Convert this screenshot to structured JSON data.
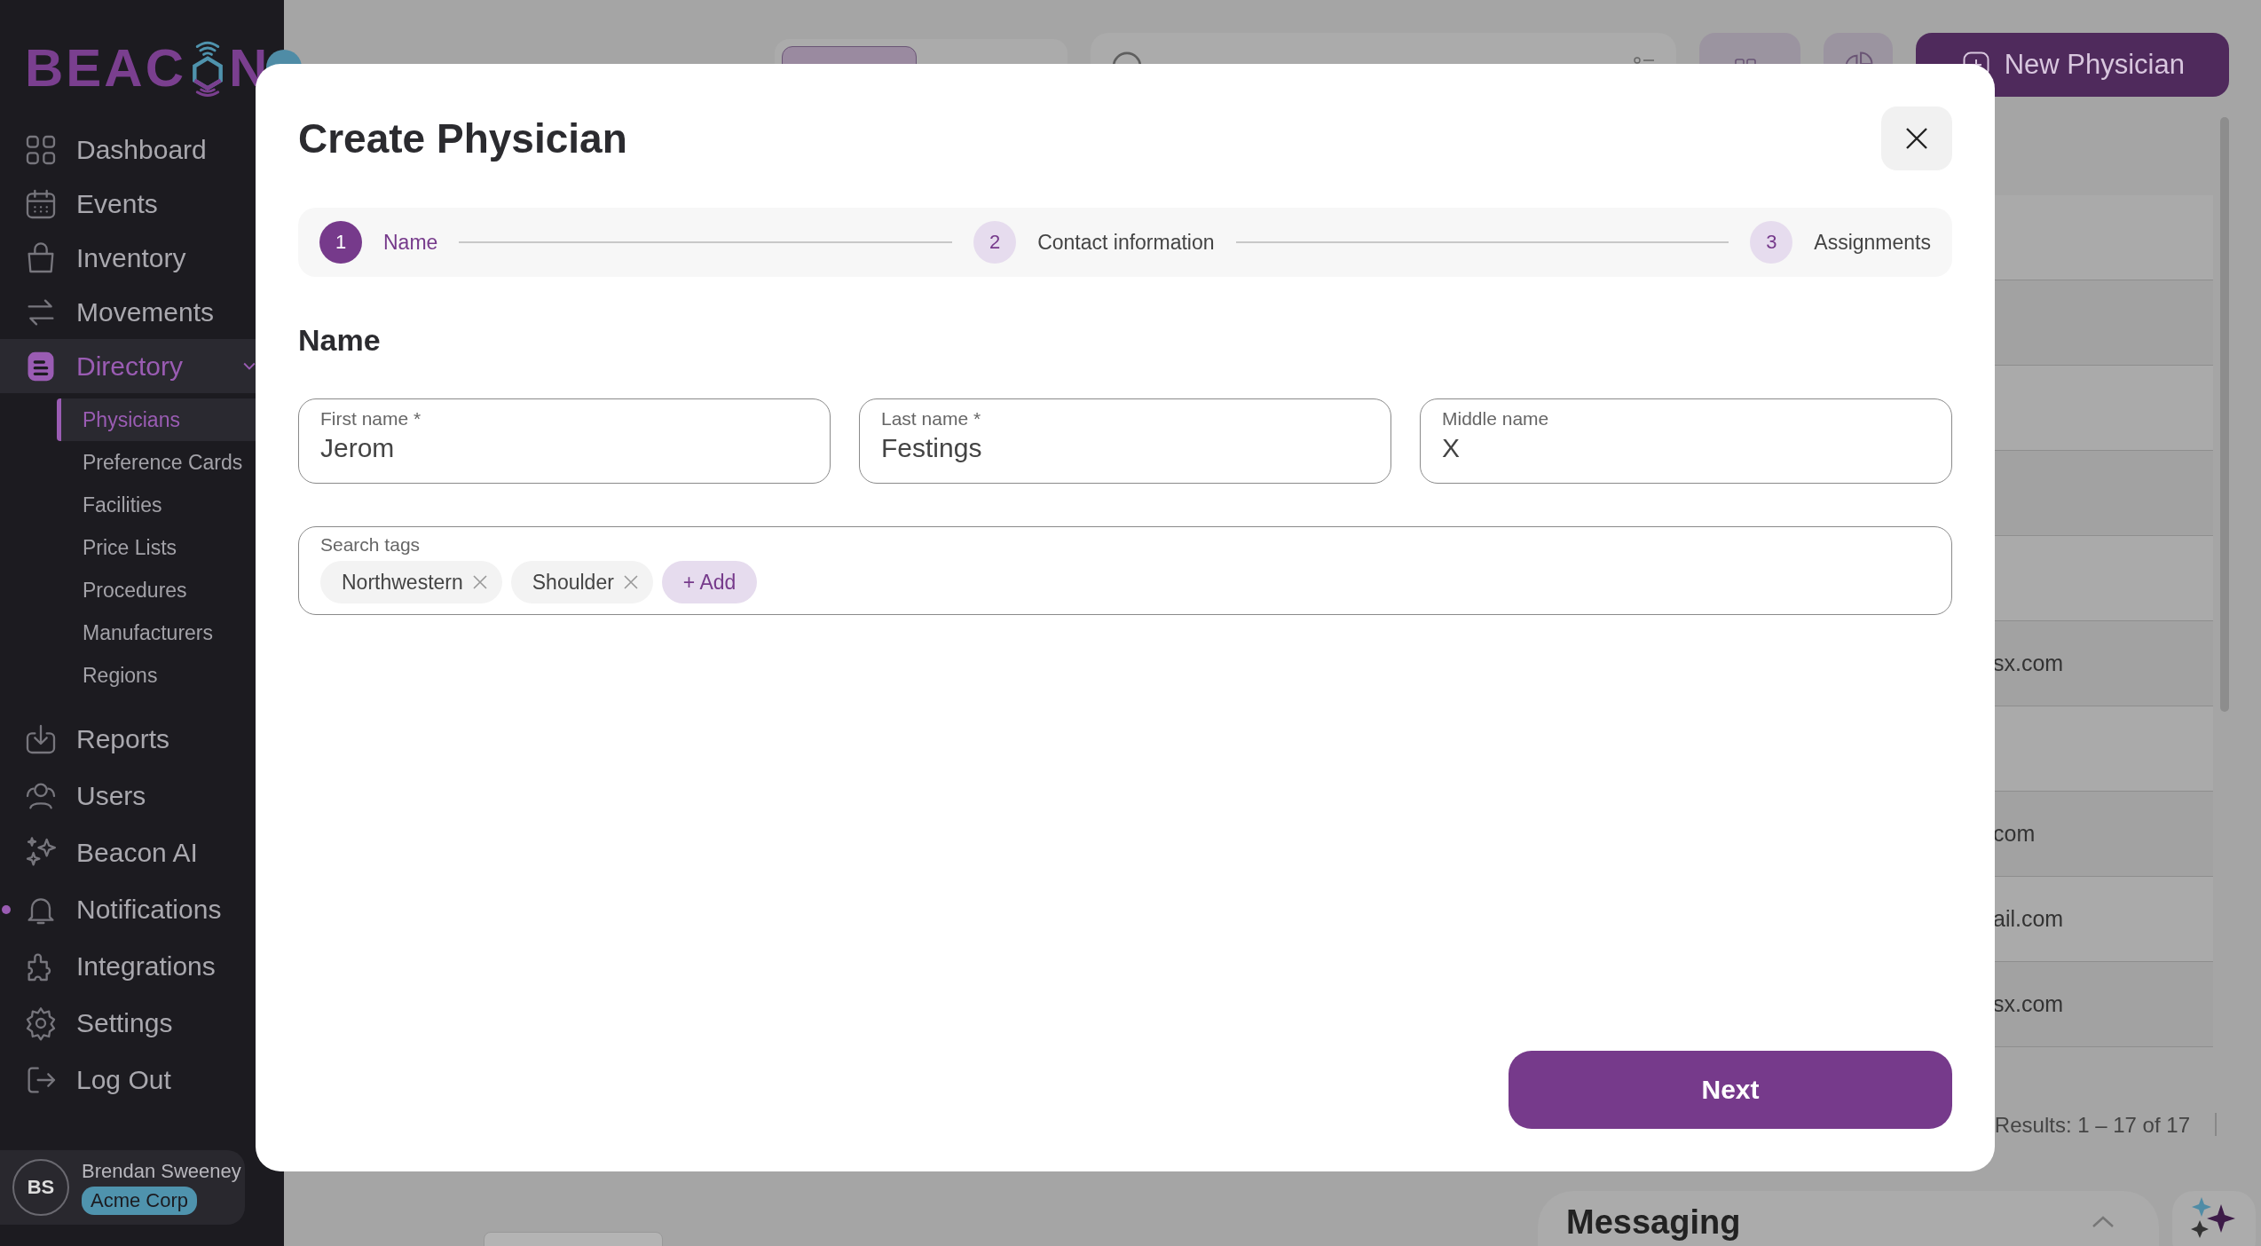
{
  "sidebar": {
    "logo": {
      "text_before": "BEAC",
      "text_after": "N"
    },
    "nav": [
      {
        "label": "Dashboard",
        "selected": false
      },
      {
        "label": "Events",
        "selected": false
      },
      {
        "label": "Inventory",
        "selected": false
      },
      {
        "label": "Movements",
        "selected": false
      },
      {
        "label": "Directory",
        "selected": true,
        "expanded": true,
        "children": [
          {
            "label": "Physicians",
            "selected": true
          },
          {
            "label": "Preference Cards",
            "selected": false
          },
          {
            "label": "Facilities",
            "selected": false
          },
          {
            "label": "Price Lists",
            "selected": false
          },
          {
            "label": "Procedures",
            "selected": false
          },
          {
            "label": "Manufacturers",
            "selected": false
          },
          {
            "label": "Regions",
            "selected": false
          }
        ]
      },
      {
        "label": "Reports",
        "selected": false
      },
      {
        "label": "Users",
        "selected": false
      },
      {
        "label": "Beacon AI",
        "selected": false
      },
      {
        "label": "Notifications",
        "selected": false,
        "unread": true
      },
      {
        "label": "Integrations",
        "selected": false
      },
      {
        "label": "Settings",
        "selected": false
      },
      {
        "label": "Log Out",
        "selected": false
      }
    ],
    "user": {
      "initials": "BS",
      "name": "Brendan Sweeney",
      "organization": "Acme Corp"
    }
  },
  "page": {
    "status_tabs": [
      {
        "selected": true
      },
      {
        "selected": false
      }
    ],
    "new_button": "New Physician",
    "rows": [
      {},
      {},
      {},
      {},
      {},
      {
        "column_3": "sx.com"
      },
      {},
      {
        "column_3": "com"
      },
      {
        "column_3": "ail.com"
      },
      {
        "column_3": "sx.com"
      }
    ],
    "results": "Results: 1 – 17 of 17",
    "messaging": {
      "title": "Messaging"
    }
  },
  "modal": {
    "title": "Create Physician",
    "steps": [
      {
        "number": "1",
        "label": "Name",
        "selected": true
      },
      {
        "number": "2",
        "label": "Contact information",
        "selected": false
      },
      {
        "number": "3",
        "label": "Assignments",
        "selected": false
      }
    ],
    "section_title": "Name",
    "fields": [
      {
        "label": "First name *",
        "value": "Jerom"
      },
      {
        "label": "Last name *",
        "value": "Festings"
      },
      {
        "label": "Middle name",
        "value": "X"
      }
    ],
    "tags_field": {
      "label": "Search tags",
      "tags": [
        "Northwestern",
        "Shoulder"
      ],
      "add_label": "+ Add"
    },
    "next_button": "Next"
  }
}
